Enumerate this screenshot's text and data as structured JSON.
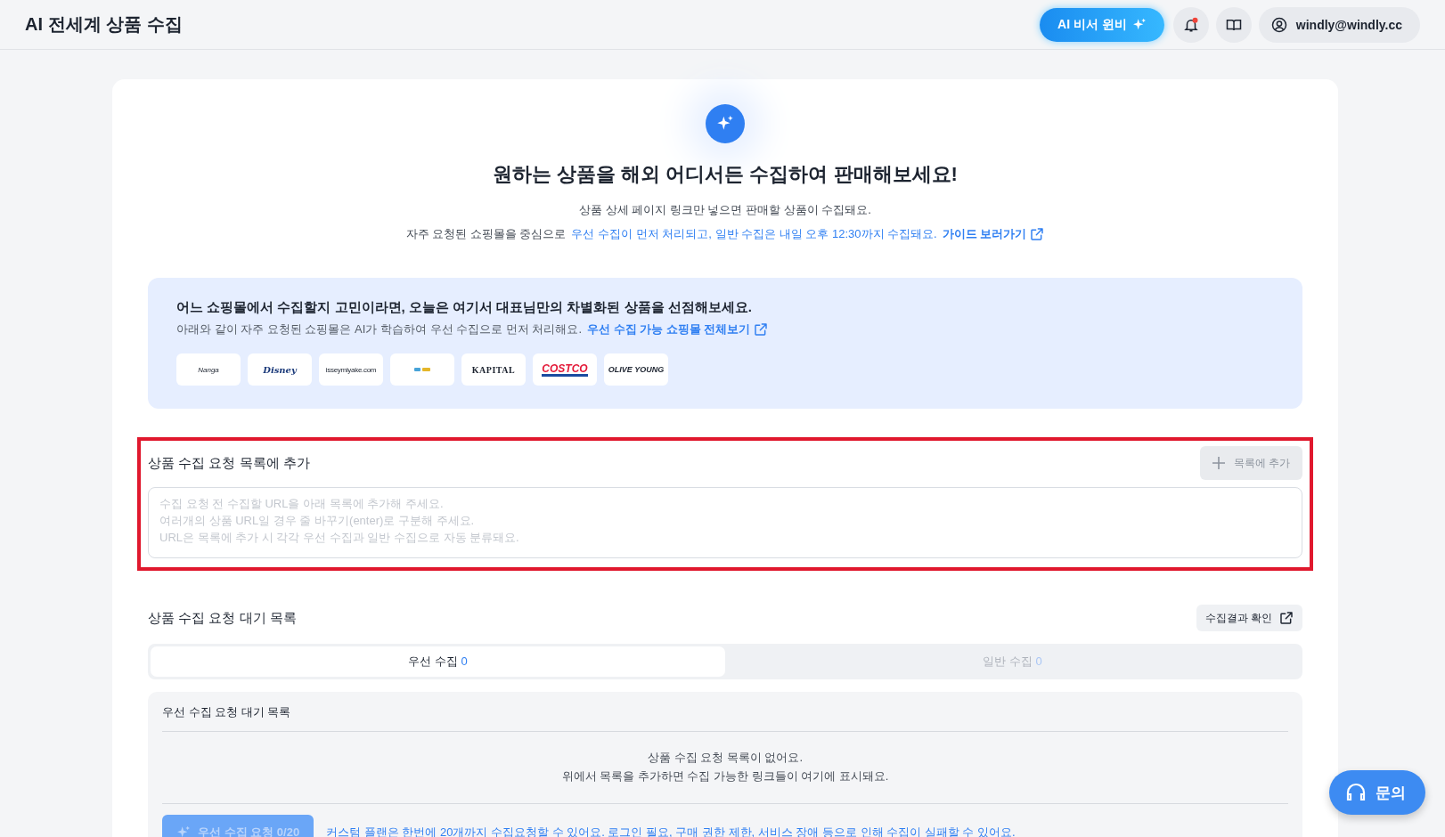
{
  "header": {
    "title": "AI 전세계 상품 수집",
    "assistant_button": "AI 비서 윈비",
    "notification_unread": true,
    "account": "windly@windly.cc"
  },
  "hero": {
    "heading": "원하는 상품을 해외 어디서든 수집하여 판매해보세요!",
    "line_1": "상품 상세 페이지 링크만 넣으면 판매할 상품이 수집돼요.",
    "line_2_prefix": "자주 요청된 쇼핑몰을 중심으로",
    "line_2_highlight": "우선 수집이 먼저 처리되고, 일반 수집은 내일 오후 12:30까지 수집돼요.",
    "guide_link": "가이드 보러가기"
  },
  "banner": {
    "title": "어느 쇼핑몰에서 수집할지 고민이라면, 오늘은 여기서 대표님만의 차별화된 상품을 선점해보세요.",
    "text": "아래와 같이 자주 요청된 쇼핑몰은 AI가 학습하여 우선 수집으로 먼저 처리해요.",
    "link": "우선 수집 가능 쇼핑몰 전체보기",
    "stores": [
      {
        "kind": "script",
        "label": "Nanga"
      },
      {
        "kind": "disney",
        "label": "Disney"
      },
      {
        "kind": "tiny",
        "label": "isseymiyake.com"
      },
      {
        "kind": "mark"
      },
      {
        "kind": "serif",
        "label": "KAPITAL"
      },
      {
        "kind": "costco",
        "label": "COSTCO"
      },
      {
        "kind": "bold",
        "label": "OLIVE YOUNG"
      }
    ]
  },
  "add_section": {
    "title": "상품 수집 요청 목록에 추가",
    "add_button": "목록에 추가",
    "add_disabled": true,
    "placeholder": "수집 요청 전 수집할 URL을 아래 목록에 추가해 주세요.\n여러개의 상품 URL일 경우 줄 바꾸기(enter)로 구분해 주세요.\nURL은 목록에 추가 시 각각 우선 수집과 일반 수집으로 자동 분류돼요."
  },
  "queue": {
    "title": "상품 수집 요청 대기 목록",
    "results_button": "수집결과 확인",
    "tabs": [
      {
        "label": "우선 수집",
        "count": "0",
        "selected": true
      },
      {
        "label": "일반 수집",
        "count": "0",
        "selected": false
      }
    ],
    "panel_title": "우선 수집 요청 대기 목록",
    "empty_line_1": "상품 수집 요청 목록이 없어요.",
    "empty_line_2": "위에서 목록을 추가하면 수집 가능한 링크들이 여기에 표시돼요.",
    "request_button": "우선 수집 요청 0/20",
    "request_disabled": true,
    "notice": "커스텀 플랜은 한번에 20개까지 수집요청할 수 있어요. 로그인 필요, 구매 권한 제한, 서비스 장애 등으로 인해 수집이 실패할 수 있어요."
  },
  "help_button": "문의"
}
